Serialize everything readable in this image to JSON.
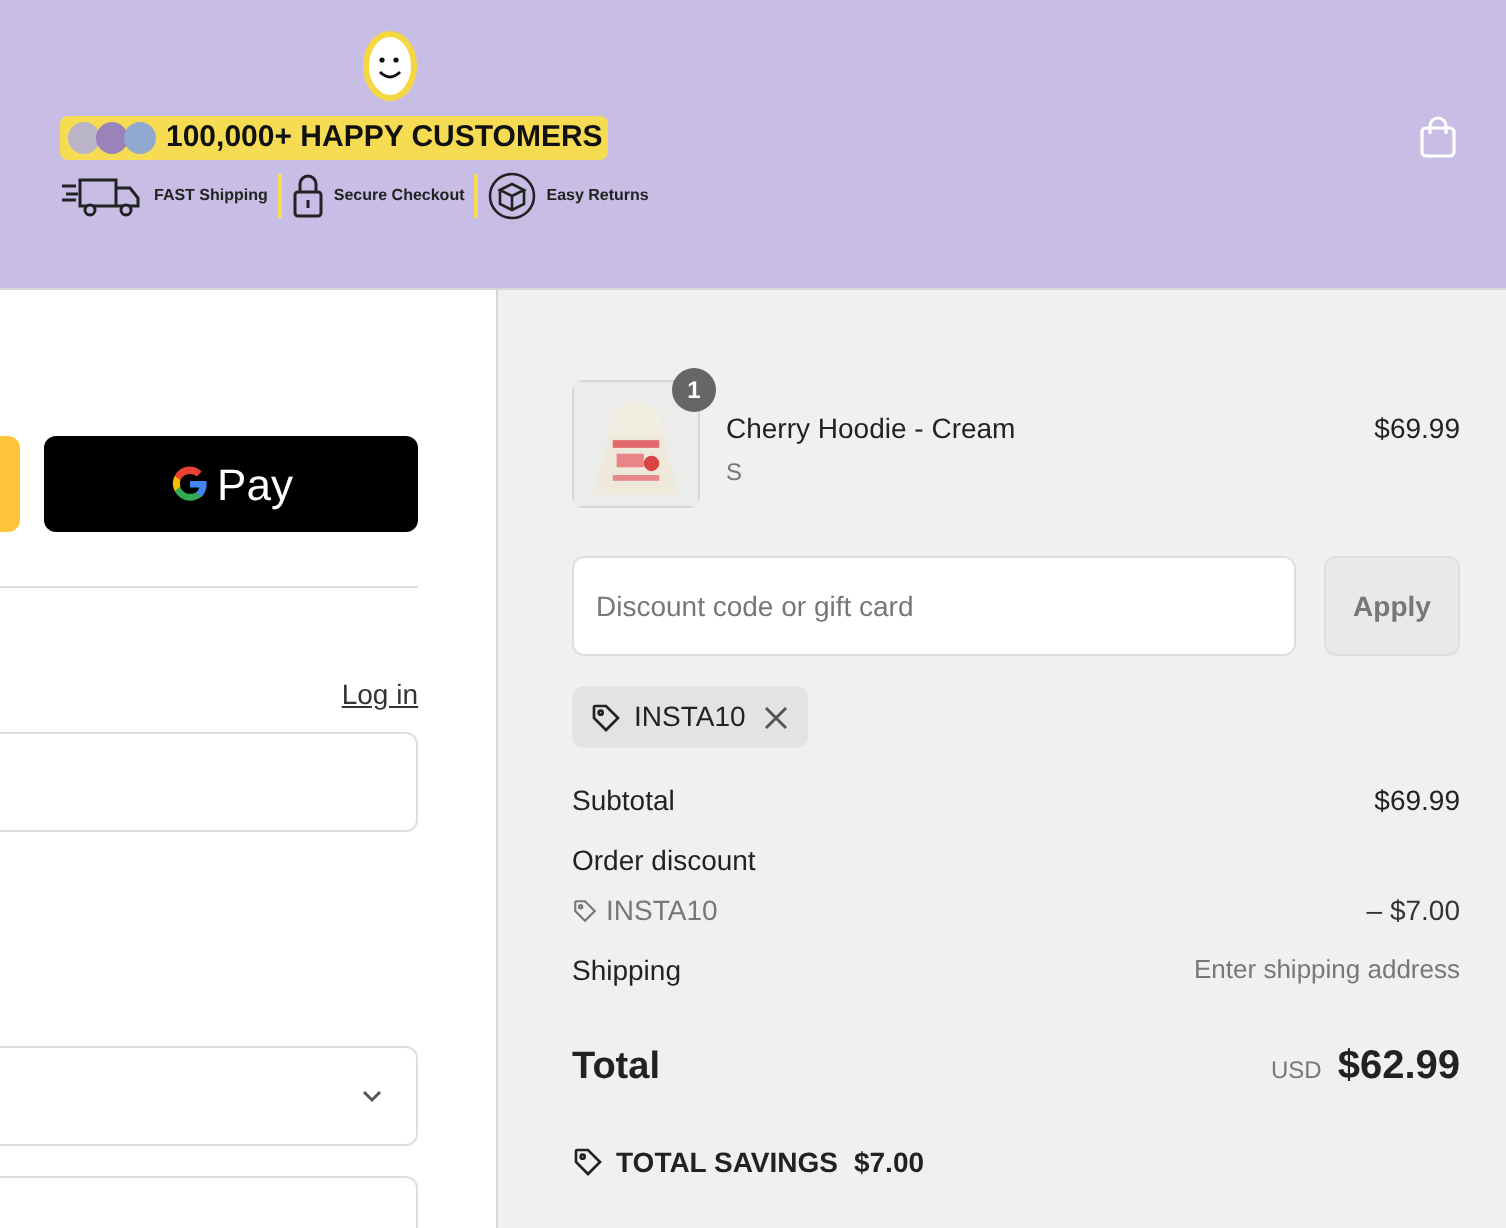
{
  "header": {
    "headline": "100,000+ HAPPY CUSTOMERS",
    "features": [
      {
        "kind": "truck",
        "label": "FAST Shipping"
      },
      {
        "kind": "lock",
        "label": "Secure Checkout"
      },
      {
        "kind": "box",
        "label": "Easy Returns"
      }
    ]
  },
  "express": {
    "gpay_label": "Pay"
  },
  "contact": {
    "login_link": "Log in"
  },
  "order": {
    "items": [
      {
        "quantity": "1",
        "name": "Cherry Hoodie - Cream",
        "variant": "S",
        "price": "$69.99"
      }
    ],
    "discount": {
      "placeholder": "Discount code or gift card",
      "apply": "Apply",
      "applied_code": "INSTA10"
    },
    "summary": [
      {
        "kind": "plain",
        "label": "Subtotal",
        "value": "$69.99"
      },
      {
        "kind": "heading",
        "label": "Order discount"
      },
      {
        "kind": "code",
        "label": "INSTA10",
        "value": "– $7.00"
      },
      {
        "kind": "muted",
        "label": "Shipping",
        "value": "Enter shipping address"
      }
    ],
    "total": {
      "label": "Total",
      "currency": "USD",
      "amount": "$62.99"
    },
    "savings": {
      "label": "TOTAL SAVINGS",
      "amount": "$7.00"
    }
  }
}
